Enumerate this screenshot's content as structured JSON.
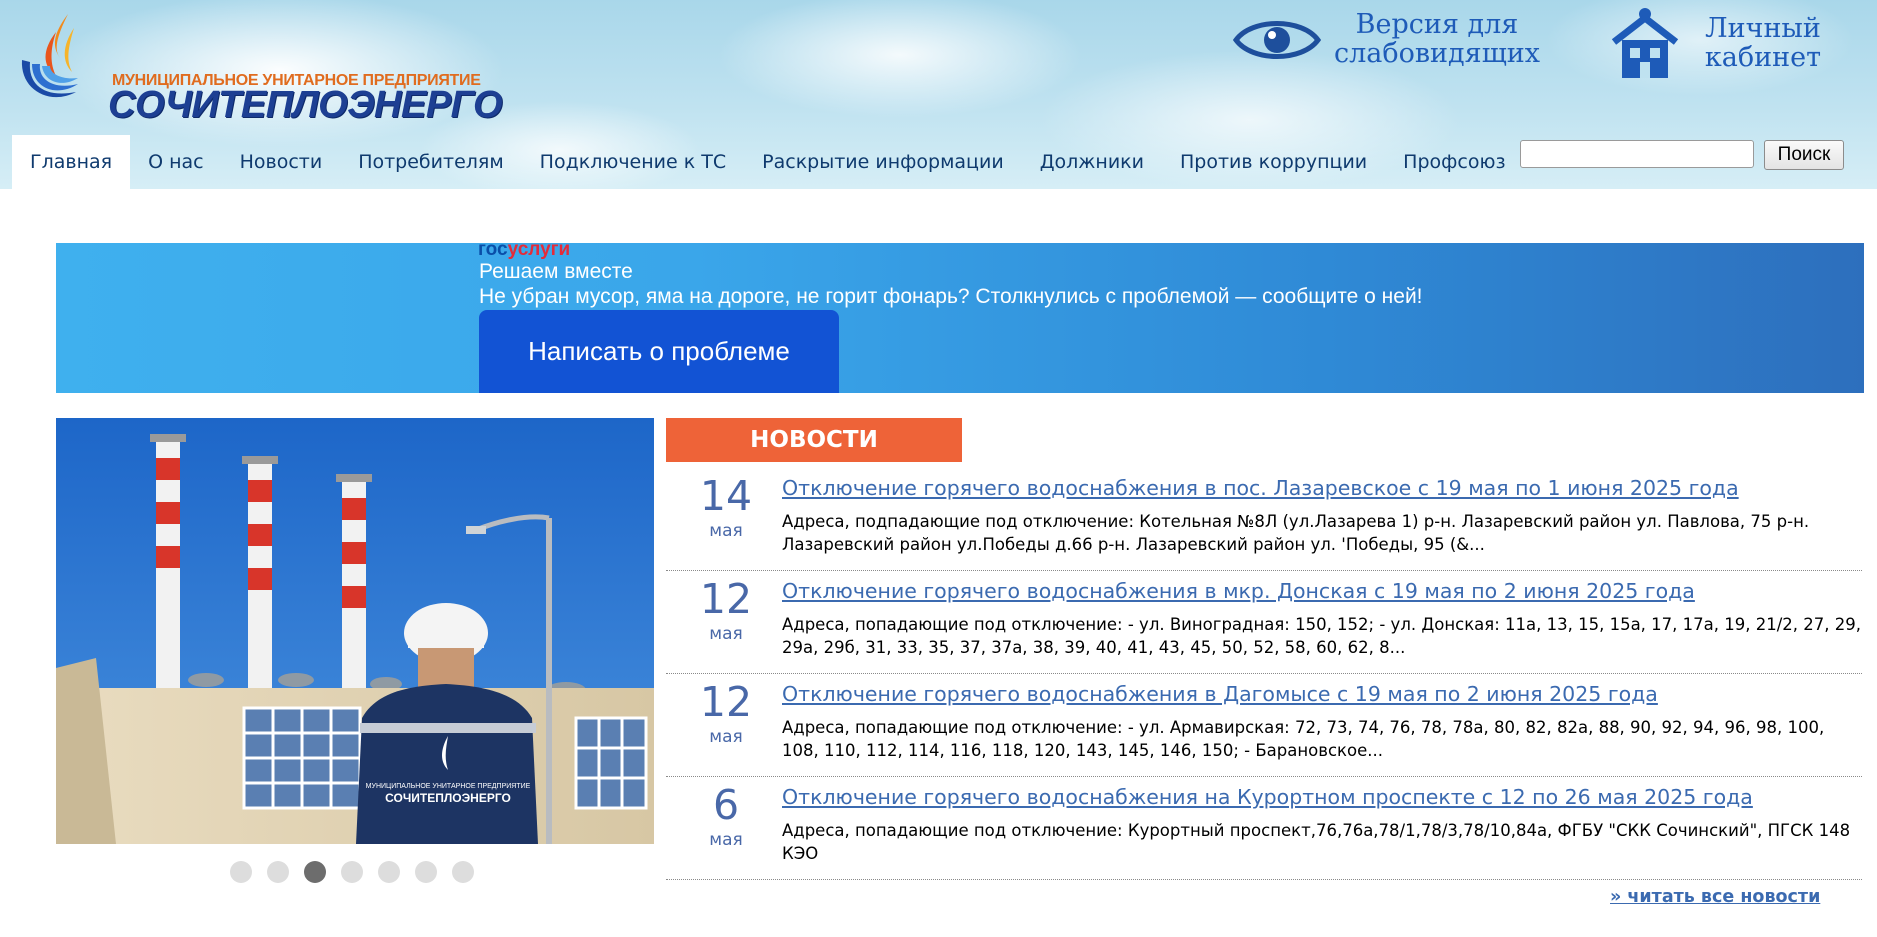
{
  "header": {
    "logo_subtitle": "Муниципальное унитарное предприятие",
    "logo_title": "СОЧИТЕПЛОЭНЕРГО",
    "accessibility_label": "Версия для слабовидящих",
    "cabinet_label": "Личный кабинет"
  },
  "nav": {
    "items": [
      {
        "label": "Главная"
      },
      {
        "label": "О нас"
      },
      {
        "label": "Новости"
      },
      {
        "label": "Потребителям"
      },
      {
        "label": "Подключение к ТС"
      },
      {
        "label": "Раскрытие информации"
      },
      {
        "label": "Должники"
      },
      {
        "label": "Против коррупции"
      },
      {
        "label": "Профсоюз"
      }
    ],
    "active_index": 0
  },
  "search": {
    "value": "",
    "button_label": "Поиск"
  },
  "banner": {
    "logo_part1": "гос",
    "logo_part2": "услуги",
    "title": "Решаем вместе",
    "text": "Не убран мусор, яма на дороге, не горит фонарь? Столкнулись с проблемой — сообщите о ней!",
    "button_label": "Написать о проблеме"
  },
  "slider": {
    "dot_count": 7,
    "active_dot": 3,
    "jacket_brand": "СОЧИТЕПЛОЭНЕРГО",
    "jacket_sub": "МУНИЦИПАЛЬНОЕ УНИТАРНОЕ ПРЕДПРИЯТИЕ"
  },
  "news": {
    "header": "НОВОСТИ",
    "items": [
      {
        "day": "14",
        "month": "мая",
        "title": "Отключение горячего водоснабжения в пос. Лазаревское с 19 мая по 1 июня 2025 года",
        "excerpt": "Адреса, подпадающие под отключение: Котельная №8Л (ул.Лазарева 1) р-н. Лазаревский район ул. Павлова, 75 р-н. Лазаревский район ул.Победы д.66 р-н. Лазаревский район ул. 'Победы, 95 (&..."
      },
      {
        "day": "12",
        "month": "мая",
        "title": "Отключение горячего водоснабжения в мкр. Донская с 19 мая по 2 июня 2025 года",
        "excerpt": "Адреса, попадающие под отключение: - ул. Виноградная: 150, 152; - ул. Донская: 11а, 13, 15, 15а, 17, 17а, 19, 21/2, 27, 29, 29а, 29б, 31, 33, 35, 37, 37а, 38, 39, 40, 41, 43, 45, 50, 52, 58, 60, 62, 8..."
      },
      {
        "day": "12",
        "month": "мая",
        "title": "Отключение горячего водоснабжения в Дагомысе с 19 мая по 2 июня 2025 года",
        "excerpt": "Адреса, попадающие под отключение: - ул. Армавирская: 72, 73, 74, 76, 78, 78а, 80, 82, 82а, 88, 90, 92, 94, 96, 98, 100, 108, 110, 112, 114, 116, 118, 120, 143, 145, 146, 150;  - Барановское..."
      },
      {
        "day": "6",
        "month": "мая",
        "title": "Отключение горячего водоснабжения на Курортном проспекте с 12 по 26 мая 2025 года",
        "excerpt": "Адреса, попадающие под отключение: Курортный проспект,76,76а,78/1,78/3,78/10,84а, ФГБУ \"СКК Сочинский\", ПГСК 148 КЭО"
      }
    ],
    "read_all_label": "» читать все новости"
  },
  "colors": {
    "nav_text": "#0f3a6e",
    "news_header_bg": "#ee6338",
    "link": "#3b6ab0",
    "banner_button": "#1253d4"
  },
  "icons": [
    "flame-logo-icon",
    "eye-icon",
    "house-icon"
  ]
}
